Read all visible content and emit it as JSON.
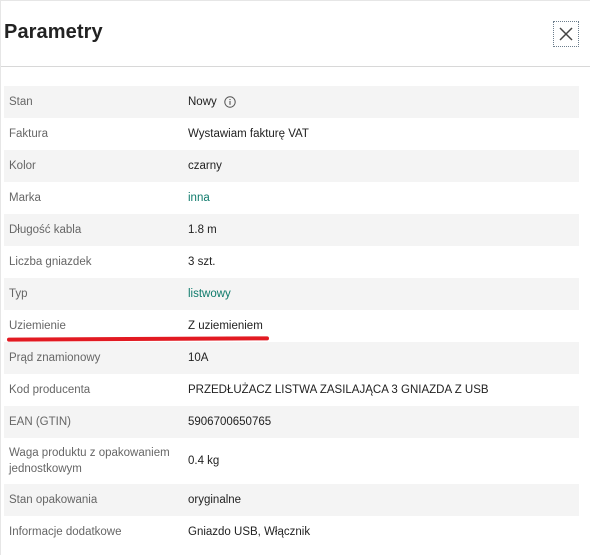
{
  "header": {
    "title": "Parametry"
  },
  "close_icon": "close-icon",
  "info_icon": "info-circle-icon",
  "params": [
    {
      "label": "Stan",
      "value": "Nowy",
      "info": true
    },
    {
      "label": "Faktura",
      "value": "Wystawiam fakturę VAT"
    },
    {
      "label": "Kolor",
      "value": "czarny"
    },
    {
      "label": "Marka",
      "value": "inna",
      "link": true
    },
    {
      "label": "Długość kabla",
      "value": "1.8 m"
    },
    {
      "label": "Liczba gniazdek",
      "value": "3 szt."
    },
    {
      "label": "Typ",
      "value": "listwowy",
      "link": true
    },
    {
      "label": "Uziemienie",
      "value": "Z uziemieniem"
    },
    {
      "label": "Prąd znamionowy",
      "value": "10A"
    },
    {
      "label": "Kod producenta",
      "value": "PRZEDŁUŻACZ LISTWA ZASILAJĄCA 3 GNIAZDA Z USB"
    },
    {
      "label": "EAN (GTIN)",
      "value": "5906700650765"
    },
    {
      "label": "Waga produktu z opakowaniem jednostkowym",
      "value": "0.4 kg"
    },
    {
      "label": "Stan opakowania",
      "value": "oryginalne"
    },
    {
      "label": "Informacje dodatkowe",
      "value": "Gniazdo USB, Włącznik"
    }
  ],
  "colors": {
    "link": "#0f7b6c",
    "highlight_underline": "#e21a22",
    "row_stripe": "#f4f4f4"
  }
}
